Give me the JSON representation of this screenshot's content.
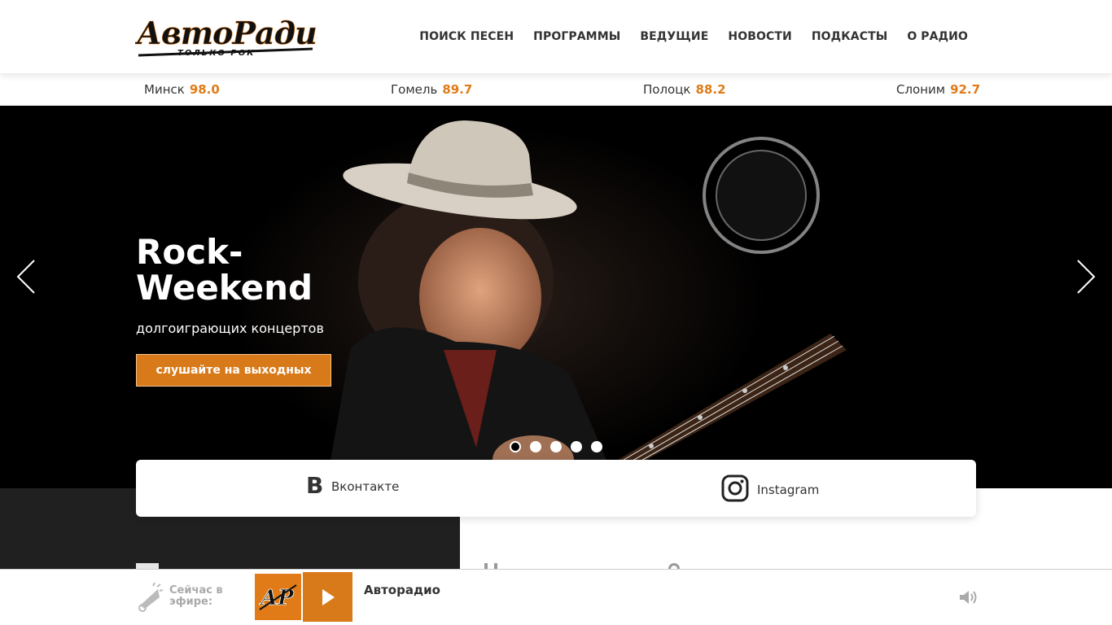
{
  "brand": {
    "logo_text": "АвтоРадио",
    "logo_tagline": "ТОЛЬКО РОК",
    "accent": "#e07b17",
    "dark": "#202020"
  },
  "nav": {
    "items": [
      "ПОИСК ПЕСЕН",
      "ПРОГРАММЫ",
      "ВЕДУЩИЕ",
      "НОВОСТИ",
      "ПОДКАСТЫ",
      "О РАДИО"
    ]
  },
  "frequencies": [
    {
      "city": "Минск",
      "freq": "98.0"
    },
    {
      "city": "Гомель",
      "freq": "89.7"
    },
    {
      "city": "Полоцк",
      "freq": "88.2"
    },
    {
      "city": "Слоним",
      "freq": "92.7"
    }
  ],
  "hero": {
    "title_line1": "Rock-",
    "title_line2": "Weekend",
    "subtitle": "долгоиграющих концертов",
    "button": "слушайте на выходных",
    "prev_icon": "chevron-left-icon",
    "next_icon": "chevron-right-icon",
    "slides_total": 5,
    "active_slide": 1
  },
  "social": {
    "vk_label": "Вконтакте",
    "instagram_label": "Instagram"
  },
  "player": {
    "on_air_label": "Сейчас в эфире:",
    "station": "Авторадио",
    "station_logo_text": "АР",
    "play_icon": "play-icon",
    "volume_icon": "volume-icon"
  }
}
